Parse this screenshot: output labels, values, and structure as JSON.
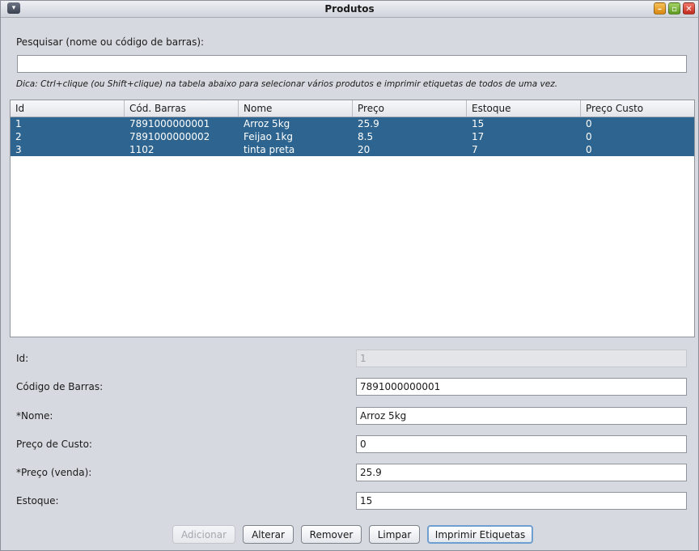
{
  "window": {
    "title": "Produtos"
  },
  "search": {
    "label": "Pesquisar (nome ou código de barras):",
    "value": "",
    "hint": "Dica: Ctrl+clique (ou Shift+clique) na tabela abaixo para selecionar vários produtos e imprimir etiquetas de todos de uma vez."
  },
  "table": {
    "columns": [
      "Id",
      "Cód. Barras",
      "Nome",
      "Preço",
      "Estoque",
      "Preço Custo"
    ],
    "rows": [
      [
        "1",
        "7891000000001",
        "Arroz 5kg",
        "25.9",
        "15",
        "0"
      ],
      [
        "2",
        "7891000000002",
        "Feijao 1kg",
        "8.5",
        "17",
        "0"
      ],
      [
        "3",
        "1102",
        "tinta preta",
        "20",
        "7",
        "0"
      ]
    ],
    "selected_rows": [
      0,
      1,
      2
    ],
    "selection_color": "#2e6590"
  },
  "form": {
    "id": {
      "label": "Id:",
      "value": "1",
      "disabled": true
    },
    "barcode": {
      "label": "Código de Barras:",
      "value": "7891000000001"
    },
    "name": {
      "label": "*Nome:",
      "value": "Arroz 5kg"
    },
    "cost": {
      "label": "Preço de Custo:",
      "value": "0"
    },
    "price": {
      "label": "*Preço (venda):",
      "value": "25.9"
    },
    "stock": {
      "label": "Estoque:",
      "value": "15"
    }
  },
  "buttons": {
    "add": "Adicionar",
    "edit": "Alterar",
    "remove": "Remover",
    "clear": "Limpar",
    "print": "Imprimir Etiquetas"
  }
}
